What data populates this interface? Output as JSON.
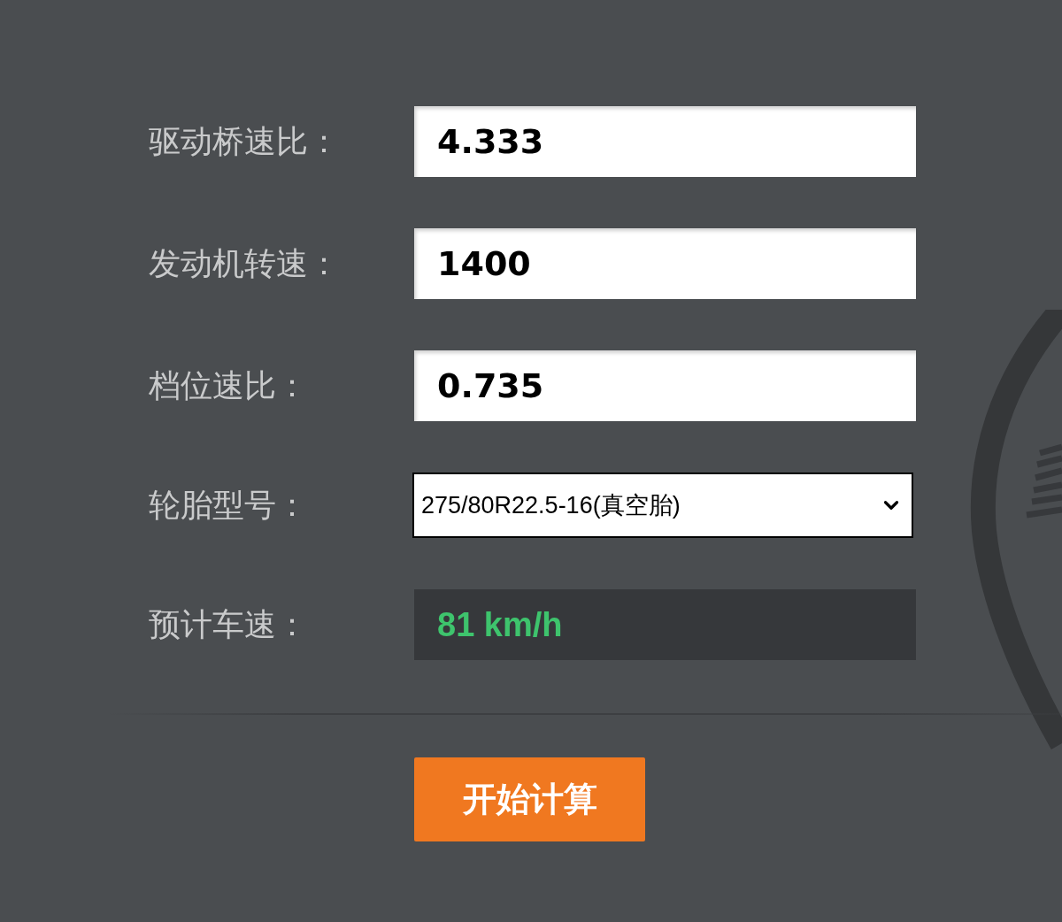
{
  "fields": [
    {
      "kind": "input",
      "label": "驱动桥速比：",
      "value": "4.333"
    },
    {
      "kind": "input",
      "label": "发动机转速：",
      "value": "1400"
    },
    {
      "kind": "input",
      "label": "档位速比：",
      "value": "0.735"
    },
    {
      "kind": "select",
      "label": "轮胎型号：",
      "value": "275/80R22.5-16(真空胎)"
    },
    {
      "kind": "result",
      "label": "预计车速：",
      "value": "81 km/h"
    }
  ],
  "button": {
    "label": "开始计算"
  }
}
